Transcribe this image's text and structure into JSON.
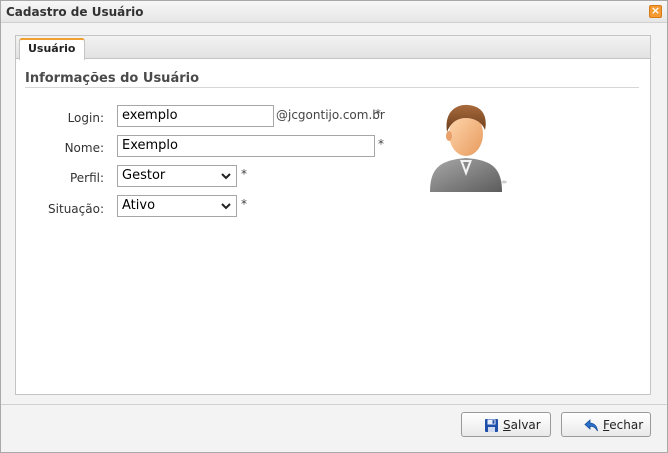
{
  "window": {
    "title": "Cadastro de Usuário",
    "close_glyph": "×"
  },
  "tabs": [
    {
      "label": "Usuário",
      "active": true
    }
  ],
  "section": {
    "title": "Informações do Usuário"
  },
  "form": {
    "login": {
      "label": "Login:",
      "value": "exemplo",
      "suffix": "@jcgontijo.com.br",
      "required": "*"
    },
    "nome": {
      "label": "Nome:",
      "value": "Exemplo",
      "required": "*"
    },
    "perfil": {
      "label": "Perfil:",
      "value": "Gestor",
      "required": "*"
    },
    "situacao": {
      "label": "Situação:",
      "value": "Ativo",
      "required": "*"
    }
  },
  "buttons": {
    "save": {
      "first": "S",
      "rest": "alvar",
      "icon": "floppy-disk-icon"
    },
    "close": {
      "first": "F",
      "rest": "echar",
      "icon": "back-arrow-icon"
    }
  },
  "colors": {
    "tab_accent": "#f0a030",
    "close_button": "#f59a32",
    "save_icon": "#1f4fa8",
    "close_icon": "#2a6fc9"
  }
}
